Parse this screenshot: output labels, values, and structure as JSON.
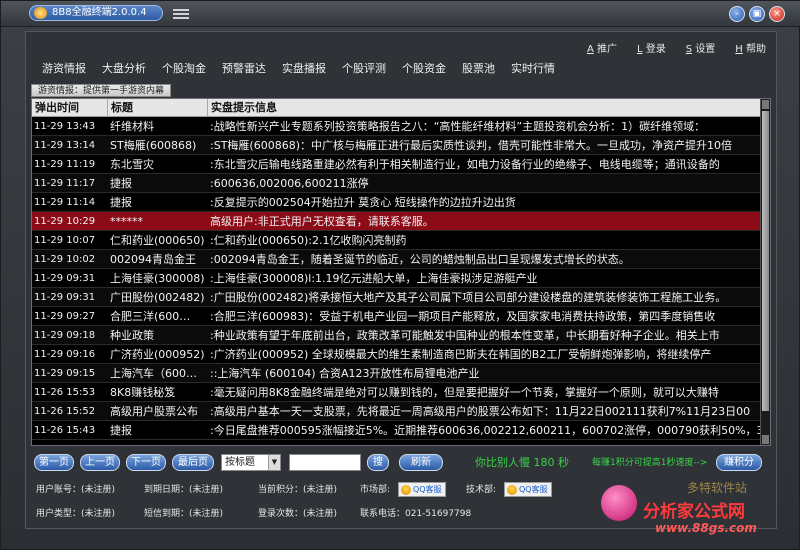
{
  "window": {
    "title": "8B8全融终端2.0.0.4",
    "buttons": {
      "minimize": "-",
      "restore": "▣",
      "close": "×"
    }
  },
  "toplinks": [
    {
      "key": "A",
      "label": "推广"
    },
    {
      "key": "L",
      "label": "登录"
    },
    {
      "key": "S",
      "label": "设置"
    },
    {
      "key": "H",
      "label": "帮助"
    }
  ],
  "nav": [
    "游资情报",
    "大盘分析",
    "个股淘金",
    "预警雷达",
    "实盘播报",
    "个股评测",
    "个股资金",
    "股票池",
    "实时行情"
  ],
  "breadcrumb": "游资情报：提供第一手游资内幕",
  "table": {
    "headers": [
      "弹出时间",
      "标题",
      "实盘提示信息"
    ],
    "rows": [
      {
        "time": "11-29 13:43",
        "title": "纤维材料",
        "info": ":战略性新兴产业专题系列投资策略报告之八：“高性能纤维材料”主题投资机会分析：1）碳纤维领域：",
        "style": "normal"
      },
      {
        "time": "11-29 13:14",
        "title": "ST梅雁(600868)",
        "info": ":ST梅雁(600868)：中广核与梅雁正进行最后实质性谈判，借壳可能性非常大。一旦成功，净资产提升10倍",
        "style": "alt"
      },
      {
        "time": "11-29 11:19",
        "title": "东北雪灾",
        "info": ":东北雪灾后输电线路重建必然有利于相关制造行业，如电力设备行业的绝缘子、电线电缆等；通讯设备的",
        "style": "normal"
      },
      {
        "time": "11-29 11:17",
        "title": "捷报",
        "info": ":600636,002006,600211涨停",
        "style": "alt"
      },
      {
        "time": "11-29 11:14",
        "title": "捷报",
        "info": ":反复提示的002504开始拉升 莫贪心 短线操作的边拉升边出货",
        "style": "normal"
      },
      {
        "time": "11-29 10:29",
        "title": "******",
        "info": " 高级用户:非正式用户无权查看，请联系客服。",
        "style": "hl"
      },
      {
        "time": "11-29 10:07",
        "title": "仁和药业(000650)",
        "info": ":仁和药业(000650):2.1亿收购闪亮制药",
        "style": "normal"
      },
      {
        "time": "11-29 10:02",
        "title": "002094青岛金王",
        "info": ":002094青岛金王，随着圣诞节的临近，公司的蜡烛制品出口呈现爆发式增长的状态。",
        "style": "alt"
      },
      {
        "time": "11-29 09:31",
        "title": "上海佳豪(300008)",
        "info": ":上海佳豪(300008)l:1.19亿元进船大单，上海佳豪拟涉足游艇产业",
        "style": "normal"
      },
      {
        "time": "11-29 09:31",
        "title": "广田股份(002482)",
        "info": ":广田股份(002482)将承接恒大地产及其子公司属下项目公司部分建设楼盘的建筑装修装饰工程施工业务。",
        "style": "alt"
      },
      {
        "time": "11-29 09:27",
        "title": "合肥三洋(600…",
        "info": ":合肥三洋(600983)：受益于机电产业园一期项目产能释放，及国家家电消费扶持政策，第四季度销售收",
        "style": "normal"
      },
      {
        "time": "11-29 09:18",
        "title": "种业政策",
        "info": ":种业政策有望于年底前出台，政策改革可能触发中国种业的根本性变革，中长期看好种子企业。相关上市",
        "style": "alt"
      },
      {
        "time": "11-29 09:16",
        "title": "广济药业(000952)",
        "info": ":广济药业(000952) 全球规模最大的维生素制造商巴斯夫在韩国的B2工厂受朝鲜炮弹影响，将继续停产",
        "style": "normal"
      },
      {
        "time": "11-29 09:15",
        "title": "上海汽车（600…",
        "info": "::上海汽车 (600104) 合资A123开放性布局锂电池产业",
        "style": "alt"
      },
      {
        "time": "11-26 15:53",
        "title": "8K8赚钱秘笈",
        "info": ":毫无疑问用8K8金融终端是绝对可以赚到钱的，但是要把握好一个节奏，掌握好一个原则，就可以大赚特",
        "style": "normal"
      },
      {
        "time": "11-26 15:52",
        "title": "高级用户股票公布",
        "info": ":高级用户基本一天一支股票，先将最近一周高级用户的股票公布如下：11月22日002111获利7%11月23日00",
        "style": "alt"
      },
      {
        "time": "11-26 15:43",
        "title": "捷报",
        "info": ":今日尾盘推荐000595涨幅接近5%。近期推荐600636,002212,600211，600702涨停，000790获利50%，30008",
        "style": "normal"
      }
    ]
  },
  "pager": {
    "first": "第一页",
    "prev": "上一页",
    "next": "下一页",
    "last": "最后页",
    "sort_value": "按标题",
    "search_button": "搜",
    "refresh": "刷新",
    "slower_text": "你比别人慢 180 秒",
    "speed_tip": "每赚1积分可提高1秒速度-->",
    "earn_button": "赚积分"
  },
  "info": {
    "account_label": "用户账号：(未注册)",
    "expire_label": "到期日期：(未注册)",
    "points_label": "当前积分：(未注册)",
    "market_label": "市场部:",
    "tech_label": "技术部:",
    "qq_label": "QQ客服",
    "type_label": "用户类型：(未注册)",
    "sms_label": "短信到期：(未注册)",
    "logins_label": "登录次数：(未注册)",
    "phone_label": "联系电话：021-51697798"
  },
  "watermark": {
    "brand": "分析家公式网",
    "url": "www.88gs.com",
    "faint": "多特软件站"
  }
}
